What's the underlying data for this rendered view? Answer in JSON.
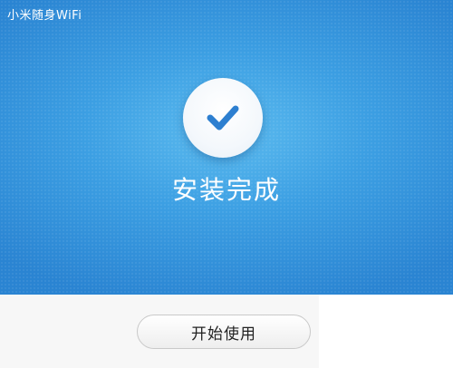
{
  "window": {
    "title": "小米随身WiFi"
  },
  "main": {
    "status_text": "安装完成",
    "icon": "checkmark-icon"
  },
  "footer": {
    "start_button_label": "开始使用"
  },
  "colors": {
    "accent_blue": "#3c9fe3",
    "check_blue": "#2d7fd0",
    "footer_bg": "#f7f7f7"
  }
}
